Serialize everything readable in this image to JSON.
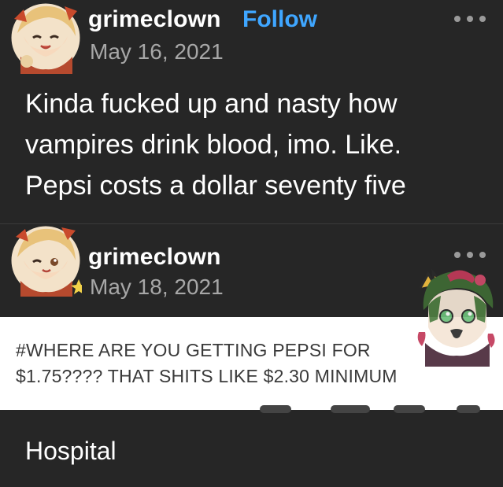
{
  "post1": {
    "username": "grimeclown",
    "follow_label": "Follow",
    "date": "May 16, 2021",
    "text_lines": [
      "Kinda fucked up and nasty how",
      "vampires drink blood, imo. Like.",
      "Pepsi costs a dollar seventy five"
    ],
    "avatar_icon": "anime-avatar-icon",
    "more_icon": "more-options-icon"
  },
  "post2": {
    "username": "grimeclown",
    "date": "May 18, 2021",
    "tags_lines": [
      "#WHERE ARE YOU GETTING PEPSI FOR",
      "$1.75???? THAT SHITS LIKE $2.30 MINIMUM"
    ],
    "avatar_icon": "anime-avatar-winking-icon",
    "more_icon": "more-options-icon",
    "sticker_icon": "green-hair-character-sticker-icon"
  },
  "footer": {
    "text": "Hospital"
  },
  "colors": {
    "background": "#262626",
    "text": "#ffffff",
    "muted": "#a7a7a7",
    "follow": "#3fa6ff",
    "tag_panel": "#ffffff",
    "tag_text": "#3a3a3a"
  }
}
